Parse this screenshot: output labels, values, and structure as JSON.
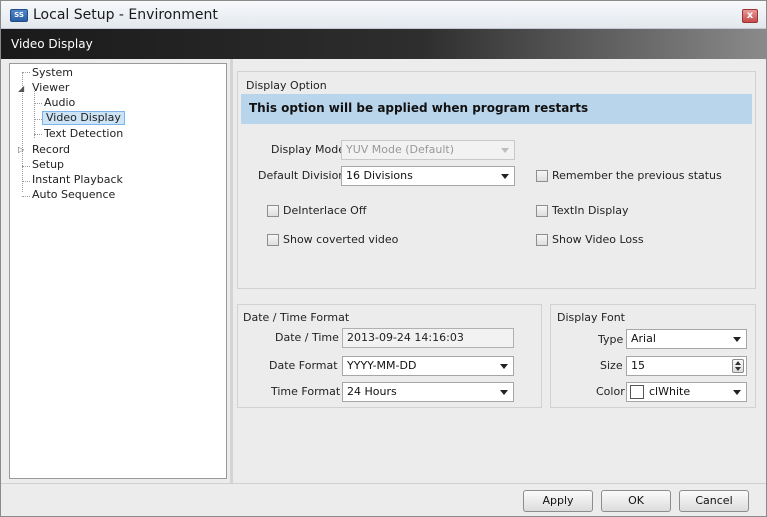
{
  "window": {
    "title": "Local Setup - Environment",
    "icon_text": "SS",
    "close_label": "x"
  },
  "section_header": "Video Display",
  "tree": {
    "items": [
      {
        "label": "System"
      },
      {
        "label": "Viewer"
      },
      {
        "label": "Audio"
      },
      {
        "label": "Video Display",
        "selected": true
      },
      {
        "label": "Text Detection"
      },
      {
        "label": "Record"
      },
      {
        "label": "Setup"
      },
      {
        "label": "Instant Playback"
      },
      {
        "label": "Auto Sequence"
      }
    ]
  },
  "display_option": {
    "group_title": "Display Option",
    "notice": "This option will be applied when program restarts",
    "display_mode_label": "Display Mode",
    "display_mode_value": "YUV Mode (Default)",
    "default_division_label": "Default Division",
    "default_division_value": "16 Divisions",
    "remember_previous_status": "Remember the previous status",
    "deinterlace_off": "DeInterlace Off",
    "textin_display": "TextIn Display",
    "show_converted_video": "Show coverted video",
    "show_video_loss": "Show Video Loss"
  },
  "datetime_format": {
    "group_title": "Date / Time Format",
    "date_time_label": "Date / Time",
    "date_time_value": "2013-09-24 14:16:03",
    "date_format_label": "Date Format",
    "date_format_value": "YYYY-MM-DD",
    "time_format_label": "Time Format",
    "time_format_value": "24 Hours"
  },
  "display_font": {
    "group_title": "Display Font",
    "type_label": "Type",
    "type_value": "Arial",
    "size_label": "Size",
    "size_value": "15",
    "color_label": "Color",
    "color_value": "clWhite",
    "swatch_color": "#ffffff"
  },
  "buttons": {
    "apply": "Apply",
    "ok": "OK",
    "cancel": "Cancel"
  },
  "colors": {
    "info_bar": "#b9d5ec",
    "header_dark": "#1a1a1a",
    "selection": "#cde4f7"
  }
}
